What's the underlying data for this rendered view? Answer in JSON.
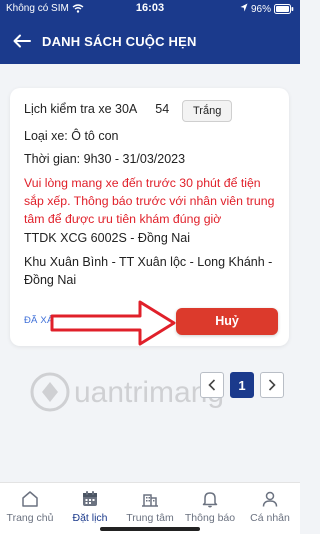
{
  "status_bar": {
    "carrier": "Không có SIM",
    "time": "16:03",
    "battery_pct": "96%"
  },
  "header": {
    "title": "DANH SÁCH CUỘC HẸN"
  },
  "appointment": {
    "title_prefix": "Lịch kiểm tra xe 30A",
    "title_suffix": "54",
    "color_badge": "Trắng",
    "vehicle_type": "Loại xe: Ô tô con",
    "time": "Thời gian: 9h30 - 31/03/2023",
    "notice": "Vui lòng mang xe đến trước 30 phút để tiện sắp xếp. Thông báo trước với nhân viên trung tâm để được ưu tiên khám đúng giờ",
    "center": "TTDK XCG 6002S - Đồng Nai",
    "address": "Khu Xuân Bình - TT Xuân lộc - Long Khánh - Đồng Nai",
    "status": "ĐÃ XÁC NHẬN",
    "cancel_label": "Huỷ"
  },
  "pagination": {
    "current_page": "1"
  },
  "tabs": [
    {
      "label": "Trang chủ",
      "icon": "home-icon"
    },
    {
      "label": "Đặt lịch",
      "icon": "calendar-icon"
    },
    {
      "label": "Trung tâm",
      "icon": "building-icon"
    },
    {
      "label": "Thông báo",
      "icon": "bell-icon"
    },
    {
      "label": "Cá nhân",
      "icon": "user-icon"
    }
  ],
  "active_tab": "Đặt lịch",
  "colors": {
    "primary": "#1b3a8c",
    "danger": "#dc3a2c",
    "notice_text": "#e0202a",
    "link": "#3e6fd8",
    "arrow_overlay": "#e0202a"
  }
}
